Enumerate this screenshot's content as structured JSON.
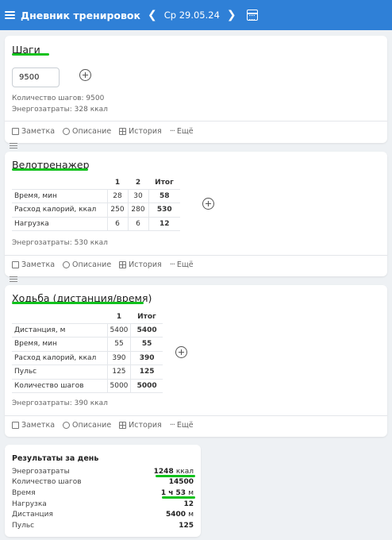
{
  "header": {
    "title": "Дневник тренировок",
    "date": "Ср 29.05.24",
    "accent": "#2f80d7"
  },
  "footer_labels": {
    "note": "Заметка",
    "description": "Описание",
    "history": "История",
    "more": "Ещё"
  },
  "steps_card": {
    "title": "Шаги",
    "input_value": "9500",
    "stats": [
      "Количество шагов: 9500",
      "Энергозатраты: 328 ккал"
    ]
  },
  "bike_card": {
    "title": "Велотренажер",
    "headers": [
      "1",
      "2",
      "Итог"
    ],
    "rows": [
      {
        "label": "Время, мин",
        "values": [
          "28",
          "30",
          "58"
        ]
      },
      {
        "label": "Расход калорий, ккал",
        "values": [
          "250",
          "280",
          "530"
        ]
      },
      {
        "label": "Нагрузка",
        "values": [
          "6",
          "6",
          "12"
        ]
      }
    ],
    "stat": "Энергозатраты: 530 ккал"
  },
  "walk_card": {
    "title": "Ходьба (дистанция/время)",
    "headers": [
      "1",
      "Итог"
    ],
    "rows": [
      {
        "label": "Дистанция, м",
        "values": [
          "5400",
          "5400"
        ]
      },
      {
        "label": "Время, мин",
        "values": [
          "55",
          "55"
        ]
      },
      {
        "label": "Расход калорий, ккал",
        "values": [
          "390",
          "390"
        ]
      },
      {
        "label": "Пульс",
        "values": [
          "125",
          "125"
        ]
      },
      {
        "label": "Количество шагов",
        "values": [
          "5000",
          "5000"
        ]
      }
    ],
    "stat": "Энергозатраты: 390 ккал"
  },
  "results": {
    "title": "Результаты за день",
    "rows": [
      {
        "label": "Энергозатраты",
        "value": "1248",
        "unit": "ккал"
      },
      {
        "label": "Количество шагов",
        "value": "14500",
        "unit": ""
      },
      {
        "label": "Время",
        "value": "1 ч 53",
        "unit": "м"
      },
      {
        "label": "Нагрузка",
        "value": "12",
        "unit": ""
      },
      {
        "label": "Дистанция",
        "value": "5400",
        "unit": "м"
      },
      {
        "label": "Пульс",
        "value": "125",
        "unit": ""
      }
    ]
  },
  "highlight_color": "#11c21d"
}
